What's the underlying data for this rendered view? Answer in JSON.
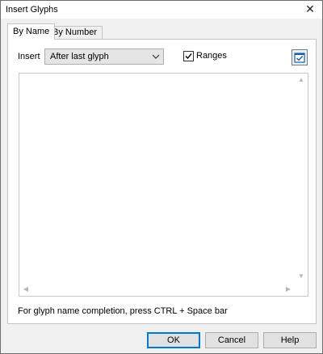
{
  "window": {
    "title": "Insert Glyphs",
    "close_glyph": "✕"
  },
  "tabs": [
    {
      "label": "By Name",
      "active": true
    },
    {
      "label": "By Number",
      "active": false
    }
  ],
  "insert": {
    "label": "Insert",
    "selected": "After last glyph"
  },
  "ranges": {
    "label": "Ranges",
    "checked": true
  },
  "glyph_text": {
    "value": ""
  },
  "hint": "For glyph name completion, press CTRL + Space bar",
  "buttons": {
    "ok": "OK",
    "cancel": "Cancel",
    "help": "Help"
  },
  "icons": {
    "close": "close-icon",
    "dropdown": "chevron-down-icon",
    "check": "check-icon",
    "toggle": "checked-toggle-icon"
  },
  "colors": {
    "accent": "#0078d7",
    "panel": "#ffffff",
    "chrome": "#f0f0f0"
  }
}
